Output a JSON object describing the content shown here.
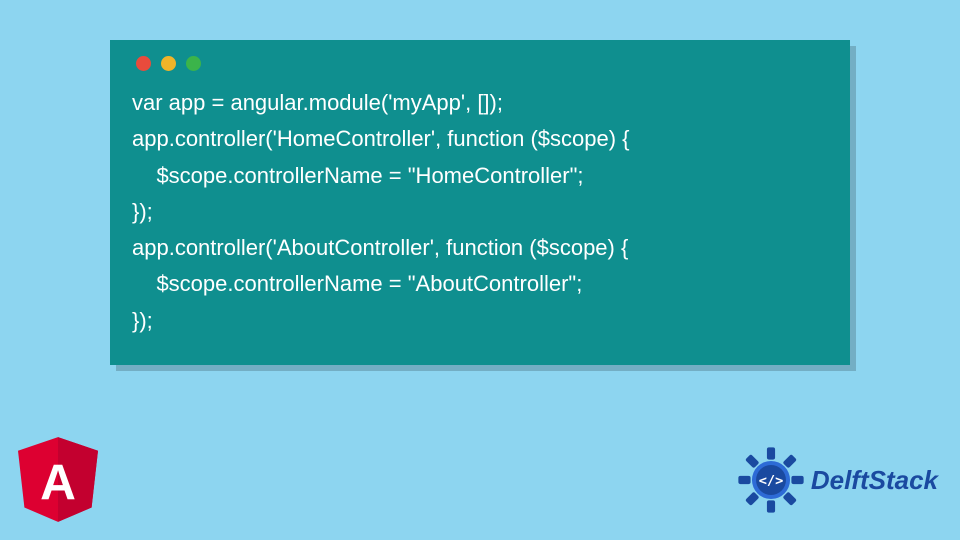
{
  "code": {
    "lines": [
      "var app = angular.module('myApp', []);",
      "app.controller('HomeController', function ($scope) {",
      "    $scope.controllerName = \"HomeController\";",
      "});",
      "app.controller('AboutController', function ($scope) {",
      "    $scope.controllerName = \"AboutController\";",
      "});"
    ]
  },
  "logos": {
    "angular_letter": "A",
    "delft_label": "DelftStack"
  },
  "window": {
    "dot_colors": {
      "red": "#e94b3c",
      "yellow": "#f0b429",
      "green": "#3bb44a"
    }
  }
}
